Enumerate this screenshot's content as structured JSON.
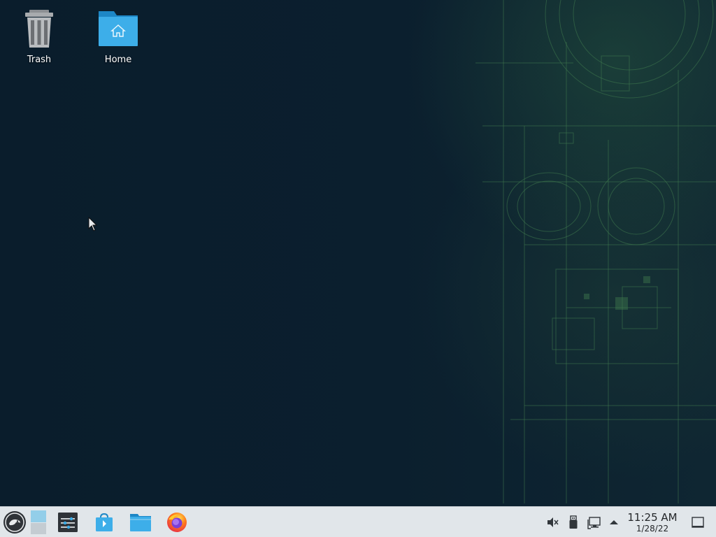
{
  "desktop": {
    "icons": [
      {
        "label": "Trash",
        "icon": "trash-icon"
      },
      {
        "label": "Home",
        "icon": "home-folder-icon"
      }
    ]
  },
  "taskbar": {
    "launcher": {
      "icon": "opensuse-logo-icon"
    },
    "pager": {
      "icon": "virtual-desktop-pager-icon"
    },
    "tasks": [
      {
        "icon": "system-settings-icon"
      },
      {
        "icon": "discover-store-icon"
      },
      {
        "icon": "dolphin-file-manager-icon"
      },
      {
        "icon": "firefox-icon"
      }
    ],
    "tray": [
      {
        "icon": "volume-muted-icon"
      },
      {
        "icon": "usb-device-icon"
      },
      {
        "icon": "network-wired-icon"
      },
      {
        "icon": "tray-expand-arrow-icon"
      }
    ],
    "clock": {
      "time": "11:25 AM",
      "date": "1/28/22"
    },
    "show_desktop": {
      "icon": "show-desktop-icon"
    }
  },
  "colors": {
    "wallpaper_base": "#0b1f2e",
    "wallpaper_accent": "#4a8a55",
    "taskbar_bg": "#e1e6ea",
    "folder_blue": "#3daee9"
  }
}
